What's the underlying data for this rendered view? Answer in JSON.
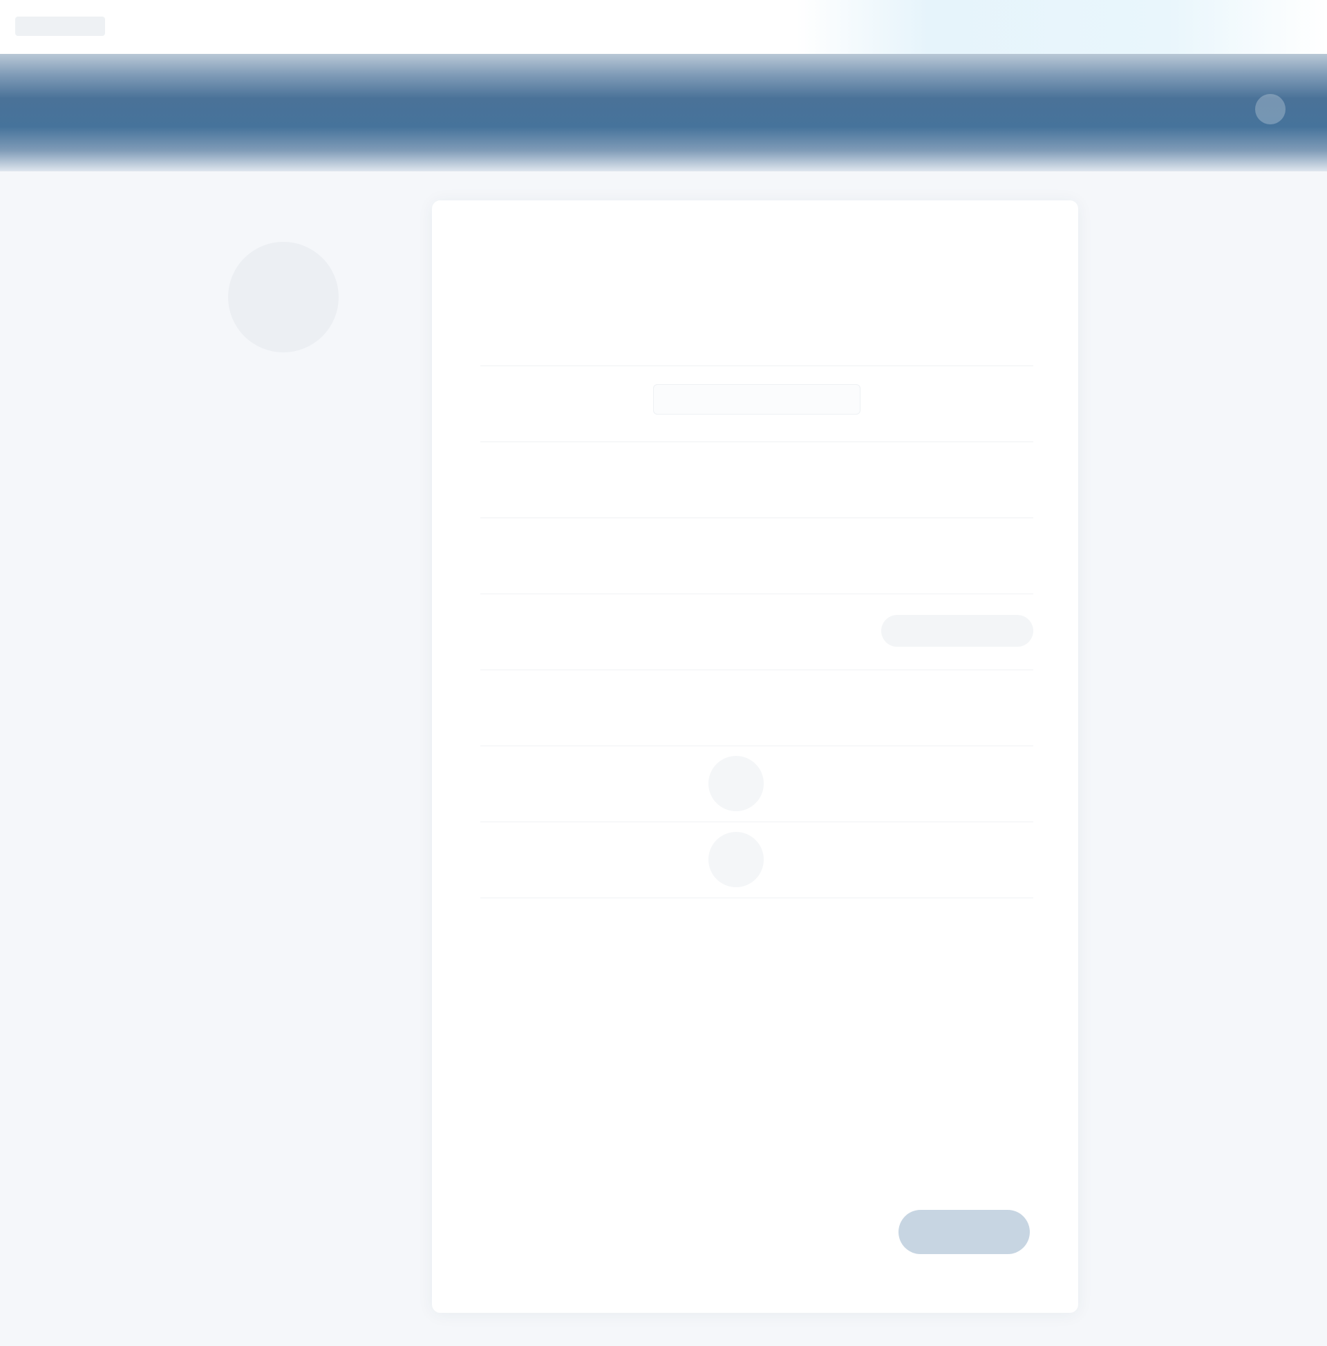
{
  "top_strip": {
    "logo_text": "",
    "meta": ""
  },
  "navbar": {
    "brand": "",
    "items": []
  },
  "sidebar": {
    "title": ""
  },
  "card": {
    "heading": ""
  },
  "rows": [
    {
      "label": "",
      "value": ""
    },
    {
      "label": "",
      "value": ""
    },
    {
      "label": "",
      "value": ""
    },
    {
      "label": "",
      "value": ""
    },
    {
      "label": "",
      "value": ""
    },
    {
      "label": "",
      "value": ""
    },
    {
      "label": "",
      "value": ""
    },
    {
      "label": "",
      "value": ""
    }
  ],
  "actions": {
    "save_label": ""
  },
  "colors": {
    "nav": "#46739b",
    "background": "#f5f7fa",
    "button": "#c7d5e2"
  }
}
